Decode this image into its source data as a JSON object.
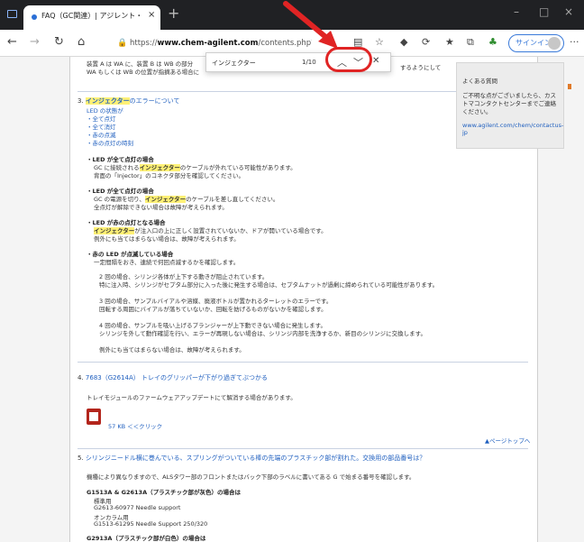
{
  "browser": {
    "tab_title": "FAQ（GC関連）| アジレント・テクノロジー",
    "tab_close": "×",
    "new_tab": "+",
    "window_controls": [
      "–",
      "□",
      "×"
    ],
    "address_prefix": "https://",
    "address_domain": "www.chem-agilent.com",
    "address_path": "/contents.php?id=1001…",
    "sync_label": "サインイン",
    "more": "···"
  },
  "find": {
    "query": "インジェクター",
    "count": "1/10",
    "up_icon": "chevron-up-icon",
    "down_icon": "chevron-down-icon",
    "close_icon": "close-icon"
  },
  "sidebox": {
    "title": "よくある質問",
    "desc": "ご不明な点がございましたら、カストマコンタクトセンターまでご連絡ください。",
    "link": "www.agilent.com/chem/contactus-jp"
  },
  "top_fragment": {
    "line1": "装置 A は WA に、装置 B は WB の部分",
    "line2": "WA もしくは WB の位置が指摘ある場合に",
    "line3": "するようにして"
  },
  "section3": {
    "num": "3.",
    "title_hl": "インジェクター",
    "title_rest": "のエラーについて",
    "links": [
      "LED の状態が",
      "・全て点灯",
      "・全て消灯",
      "・赤の点滅",
      "・赤の点灯の時刻"
    ],
    "all_on_head": "・LED が全て点灯の場合",
    "all_on_1a": "GC に接続される",
    "all_on_1hl": "インジェクター",
    "all_on_1b": "のケーブルが外れている可能性があります。",
    "all_on_2": "背面の「Injector」のコネクタ部分を確認してください。",
    "all_off_head": "・LED が全て点灯の場合",
    "all_off_1a": "GC の電源を切り、",
    "all_off_1hl": "インジェクター",
    "all_off_1b": "のケーブルを差し直してください。",
    "all_off_2": "全点灯が解除できない場合は故障が考えられます。",
    "red_on_head": "・LED が赤の点灯となる場合",
    "red_on_1hl": "インジェクター",
    "red_on_1b": "が注入口の上に正しく設置されていないか、ドアが開いている場合です。",
    "red_on_2": "例外にも当てはまらない場合は、故障が考えられます。",
    "red_blink_head": "・赤の LED が点滅している場合",
    "red_blink_1": "一定間隔をおき、連続で何回点滅するかを確認します。",
    "p2a": "2 回の場合、シリンジ各体が上下する動きが阻止されています。",
    "p2b": "特に注入時、シリンジがセプタム部分に入った後に発生する場合は、セプタムナットが過剰に締められている可能性があります。",
    "p3a": "3 回の場合、サンプルバイアルや溶媒、廃液ボトルが置かれるターレットのエラーです。",
    "p3b": "回転する周囲にバイアルが落ちていないか、回転を妨げるものがないかを確認します。",
    "p4a": "4 回の場合、サンプルを吸い上げるプランジャーが上下動できない場合に発生します。",
    "p4b": "シリンジを外して動作確認を行い、エラーが再現しない場合は、シリンジ内部を洗浄するか、新目のシリンジに交換します。",
    "p5": "例外にも当てはまらない場合は、故障が考えられます。"
  },
  "section4": {
    "num": "4.",
    "title": "7683（G2614A） トレイのグリッパーが下がり過ぎてぶつかる",
    "body": "トレイモジュールのファームウェアアップデートにて解消する場合があります。",
    "file": "57 KB ＜＜クリック",
    "page_top": "▲ページトップへ"
  },
  "section5": {
    "num": "5.",
    "title": "シリンジニードル横に巻んでいる、スプリングがついている棒の先端のプラスチック部が割れた。交換用の部品番号は？",
    "body": "機種により異なりますので、ALSタワー部のフロントまたはバック下部のラベルに書いてある G で始まる番号を確認します。",
    "sub1": "G1513A & G2613A（プラスチック部が灰色）の場合は",
    "l1": "標準用",
    "l2": "G2613-60977 Needle support",
    "l3": "オンカラム用",
    "l4": "G1513-61295 Needle Support 250/320",
    "sub2": "G2913A（プラスチック部が白色）の場合は"
  }
}
